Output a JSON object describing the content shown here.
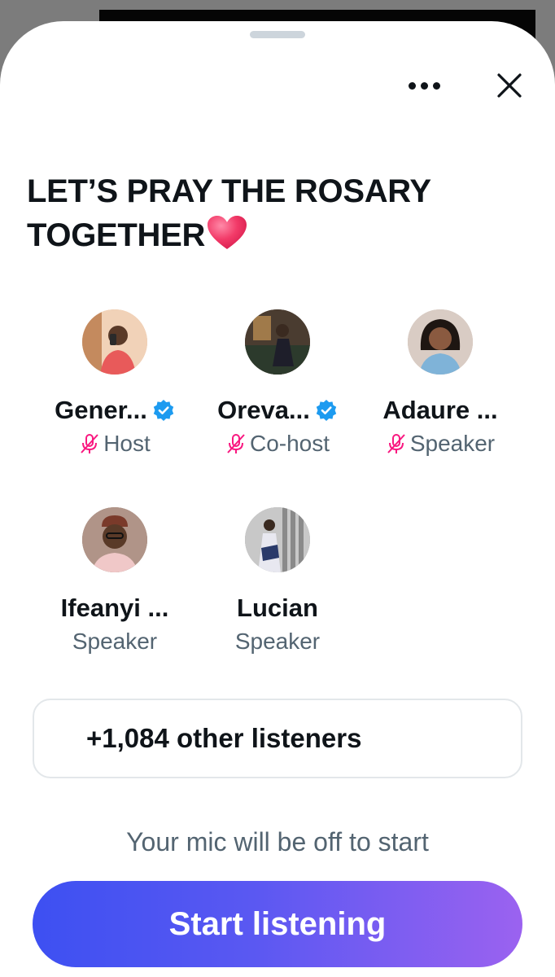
{
  "space": {
    "title": "LET’S PRAY THE ROSARY TOGETHER",
    "title_emoji": "heart-emoji"
  },
  "header": {
    "more_icon": "more-horizontal-icon",
    "close_icon": "close-icon"
  },
  "participants": [
    {
      "name": "Gener...",
      "role": "Host",
      "verified": true,
      "muted": true,
      "avatar_bg": "#e7b08a"
    },
    {
      "name": "Oreva...",
      "role": "Co-host",
      "verified": true,
      "muted": true,
      "avatar_bg": "#5c4a38"
    },
    {
      "name": "Adaure ...",
      "role": "Speaker",
      "verified": false,
      "muted": true,
      "avatar_bg": "#c9b4a8"
    },
    {
      "name": "Ifeanyi ...",
      "role": "Speaker",
      "verified": false,
      "muted": false,
      "avatar_bg": "#8a6a5a"
    },
    {
      "name": "Lucian",
      "role": "Speaker",
      "verified": false,
      "muted": false,
      "avatar_bg": "#9a9a9a"
    }
  ],
  "listeners": {
    "label": "+1,084 other listeners"
  },
  "mic_note": "Your mic will be off to start",
  "start_button": {
    "label": "Start listening"
  },
  "colors": {
    "text_primary": "#0f1419",
    "text_secondary": "#536471",
    "verified": "#1d9bf0",
    "mic_off": "#f91880",
    "button_gradient_start": "#3d50f2",
    "button_gradient_end": "#9b62f0"
  }
}
